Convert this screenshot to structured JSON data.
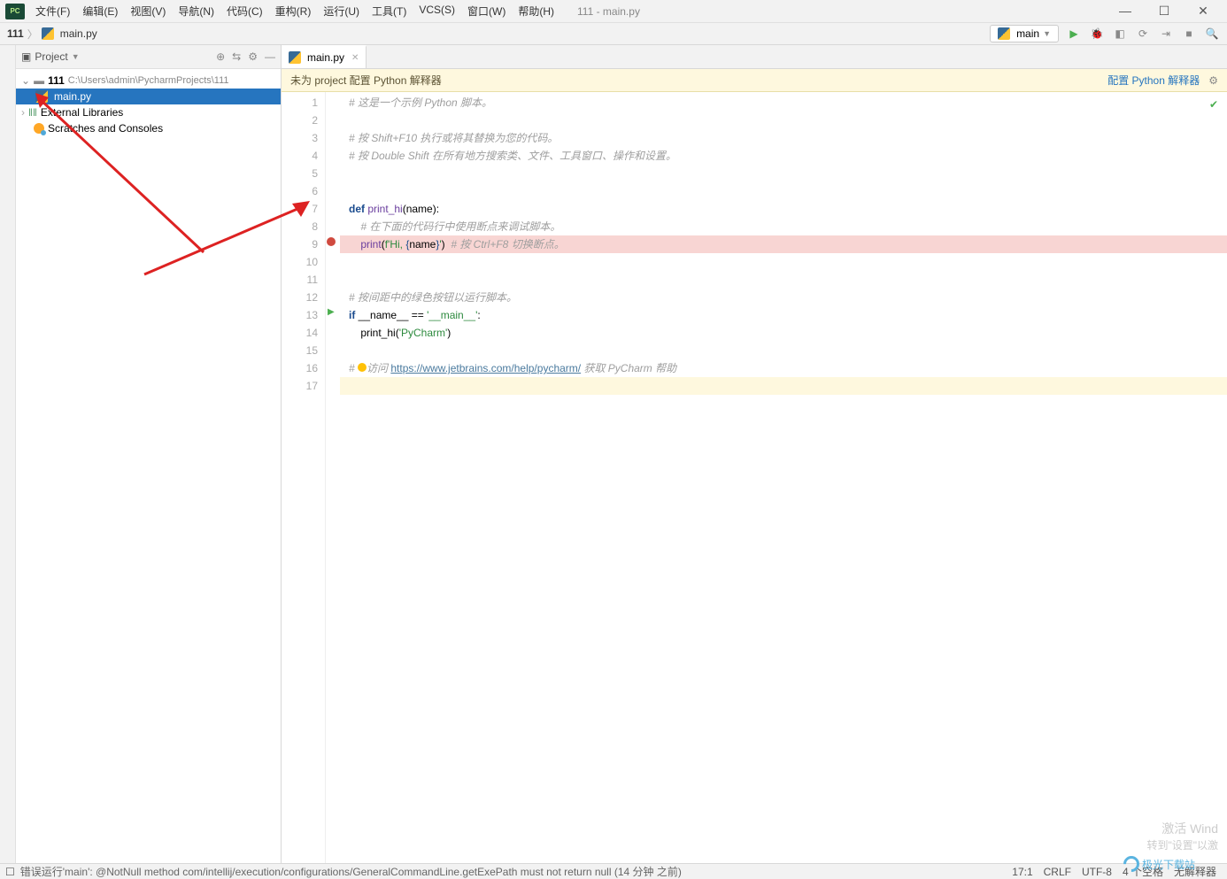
{
  "title": "111 - main.py",
  "menu": [
    "文件(F)",
    "编辑(E)",
    "视图(V)",
    "导航(N)",
    "代码(C)",
    "重构(R)",
    "运行(U)",
    "工具(T)",
    "VCS(S)",
    "窗口(W)",
    "帮助(H)"
  ],
  "breadcrumb": {
    "project": "111",
    "file": "main.py"
  },
  "run_config": {
    "label": "main"
  },
  "sidebar": {
    "title": "Project",
    "root": "111",
    "root_path": "C:\\Users\\admin\\PycharmProjects\\111",
    "items": [
      "main.py",
      "External Libraries",
      "Scratches and Consoles"
    ]
  },
  "tab": {
    "name": "main.py"
  },
  "warning": {
    "text": "未为 project 配置 Python 解释器",
    "link": "配置 Python 解释器"
  },
  "code": {
    "lines": [
      "# 这是一个示例 Python 脚本。",
      "",
      "# 按 Shift+F10 执行或将其替换为您的代码。",
      "# 按 Double Shift 在所有地方搜索类、文件、工具窗口、操作和设置。",
      "",
      "",
      "def print_hi(name):",
      "    # 在下面的代码行中使用断点来调试脚本。",
      "    print(f'Hi, {name}')  # 按 Ctrl+F8 切换断点。",
      "",
      "",
      "# 按间距中的绿色按钮以运行脚本。",
      "if __name__ == '__main__':",
      "    print_hi('PyCharm')",
      "",
      "# 访问 https://www.jetbrains.com/help/pycharm/ 获取 PyCharm 帮助",
      ""
    ],
    "url": "https://www.jetbrains.com/help/pycharm/",
    "breakpoint_line": 9,
    "run_marker_line": 13,
    "current_line": 17
  },
  "statusbar": {
    "error": "错误运行'main': @NotNull method com/intellij/execution/configurations/GeneralCommandLine.getExePath must not return null (14 分钟 之前)",
    "pos": "17:1",
    "sep": "CRLF",
    "enc": "UTF-8",
    "indent": "4 个空格",
    "interp": "无解释器"
  },
  "watermark": {
    "line1": "激活 Wind",
    "line2": "转到\"设置\"以激",
    "logo": "极光下载站"
  }
}
